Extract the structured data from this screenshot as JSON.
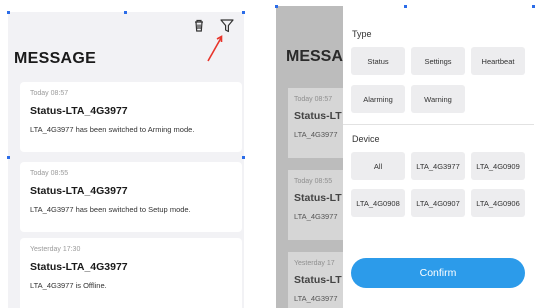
{
  "left": {
    "title": "MESSAGE",
    "messages": [
      {
        "time": "Today 08:57",
        "title": "Status-LTA_4G3977",
        "body": "LTA_4G3977 has been switched to Arming mode."
      },
      {
        "time": "Today 08:55",
        "title": "Status-LTA_4G3977",
        "body": "LTA_4G3977 has been switched to Setup mode."
      },
      {
        "time": "Yesterday 17:30",
        "title": "Status-LTA_4G3977",
        "body": "LTA_4G3977 is Offline."
      }
    ]
  },
  "right": {
    "background": {
      "title": "MESSAG",
      "messages": [
        {
          "time": "Today 08:57",
          "title": "Status-LT",
          "body": "LTA_4G3977"
        },
        {
          "time": "Today 08:55",
          "title": "Status-LT",
          "body": "LTA_4G3977"
        },
        {
          "time": "Yesterday 17",
          "title": "Status-LT",
          "body": "LTA_4G3977"
        }
      ]
    },
    "filter": {
      "type_label": "Type",
      "type_options": [
        "Status",
        "Settings",
        "Heartbeat",
        "Alarming",
        "Warning"
      ],
      "device_label": "Device",
      "device_options": [
        "All",
        "LTA_4G3977",
        "LTA_4G0909",
        "LTA_4G0908",
        "LTA_4G0907",
        "LTA_4G0906"
      ],
      "confirm_label": "Confirm"
    }
  },
  "colors": {
    "accent": "#2c9bea",
    "annotation_arrow": "#e8352b",
    "selection_handle": "#2b6ce8"
  }
}
